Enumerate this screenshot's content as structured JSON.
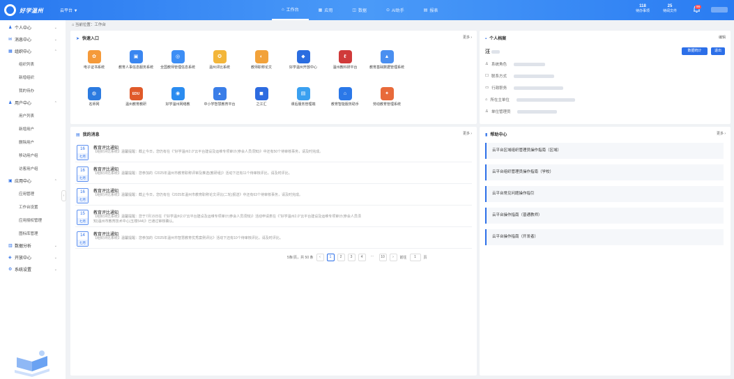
{
  "header": {
    "brand": "好学温州",
    "platform": "云平台 ▼",
    "nav": [
      {
        "label": "工作台",
        "icon": "home-icon",
        "active": true
      },
      {
        "label": "应用",
        "icon": "grid-icon",
        "active": false
      },
      {
        "label": "数据",
        "icon": "data-icon",
        "active": false
      },
      {
        "label": "AI助手",
        "icon": "ai-icon",
        "active": false
      },
      {
        "label": "报表",
        "icon": "report-icon",
        "active": false
      }
    ],
    "stat1_value": "118",
    "stat1_label": "待办事项",
    "stat2_value": "25",
    "stat2_label": "待阅文件",
    "notification_count": "99"
  },
  "sidebar": {
    "groups": [
      {
        "label": "个人中心",
        "icon": "user-icon",
        "expanded": false,
        "subs": []
      },
      {
        "label": "消息中心",
        "icon": "message-icon",
        "expanded": false,
        "subs": []
      },
      {
        "label": "组织中心",
        "icon": "org-icon",
        "expanded": true,
        "subs": [
          "组织列表",
          "新增组织",
          "我的待办"
        ]
      },
      {
        "label": "用户中心",
        "icon": "users-icon",
        "expanded": true,
        "subs": [
          "用户列表",
          "新增用户",
          "删除用户",
          "移动用户组",
          "访客用户组"
        ]
      },
      {
        "label": "应用中心",
        "icon": "app-icon",
        "expanded": true,
        "subs": [
          "应用管理",
          "工作台设置",
          "应用授权管理",
          "图标库管理"
        ]
      },
      {
        "label": "数据分析",
        "icon": "chart-icon",
        "expanded": false,
        "subs": []
      },
      {
        "label": "开放中心",
        "icon": "open-icon",
        "expanded": false,
        "subs": []
      },
      {
        "label": "系统设置",
        "icon": "settings-icon",
        "expanded": false,
        "subs": []
      }
    ]
  },
  "breadcrumb": "当前位置：工作台",
  "quick": {
    "title": "快速入口",
    "more": "更多 ›",
    "apps": [
      {
        "label": "电子证书系统",
        "color": "#f59a3a",
        "glyph": "✿"
      },
      {
        "label": "教育人事信息服务系统",
        "color": "#3a86f0",
        "glyph": "▣"
      },
      {
        "label": "全国教师管理信息系统",
        "color": "#3d8ef5",
        "glyph": "◎"
      },
      {
        "label": "温州评比系统",
        "color": "#f3b63a",
        "glyph": "✪"
      },
      {
        "label": "教师职称论文",
        "color": "#f2a23a",
        "glyph": "◐"
      },
      {
        "label": "好学温州开放中心",
        "color": "#2b6de0",
        "glyph": "◆"
      },
      {
        "label": "温州教科研平台",
        "color": "#d03a3a",
        "glyph": "ℓ"
      },
      {
        "label": "教育基础数据管理系统",
        "color": "#4a8ff0",
        "glyph": "▲"
      },
      {
        "label": "名师网",
        "color": "#2c7be0",
        "glyph": "◍"
      },
      {
        "label": "温州教育教研",
        "color": "#e05a2a",
        "glyph": "EDU"
      },
      {
        "label": "好学温州网络教",
        "color": "#2b8cf0",
        "glyph": "◉"
      },
      {
        "label": "中小学智慧教育平台",
        "color": "#3a7ee8",
        "glyph": "▴"
      },
      {
        "label": "之江汇",
        "color": "#2d6be0",
        "glyph": "◼"
      },
      {
        "label": "课后服务管理端",
        "color": "#3aa0f0",
        "glyph": "▤"
      },
      {
        "label": "教育智能服务助手",
        "color": "#2b78e8",
        "glyph": "⌂"
      },
      {
        "label": "劳动教育管理系统",
        "color": "#e86a3a",
        "glyph": "✦"
      }
    ]
  },
  "messages": {
    "title": "我的消息",
    "more": "更多 ›",
    "items": [
      {
        "day": "16",
        "month": "七月",
        "title": "教育评比通知",
        "body": "【组织评比系统】温馨提醒：截止今日，您仍有在《“好学温州2.0”云平台建设及运维专项审计(参会人员须知)》中还有50个待审核事务，请及时完成。"
      },
      {
        "day": "16",
        "month": "七月",
        "title": "教育评比通知",
        "body": "【组织评比系统】温馨提醒：您参加的《2025年温州市教育职称评审及推选(教研组)》活动下还有11个待审核评比，请及时评比。"
      },
      {
        "day": "16",
        "month": "七月",
        "title": "教育评比通知",
        "body": "【组织评比系统】温馨提醒：截止今日，您仍有在《2025年温州市教育职称论文评比(二轮)报送》中还有63个待审核事务，请及时完成。"
      },
      {
        "day": "15",
        "month": "七月",
        "title": "教育评比通知",
        "body": "【组织评比系统】温馨提醒：您于7月15日在《“好学温州2.0”云平台建设及运维专项审计(参会人员须知)》活动申请表在《“好学温州2.0”云平台建设及运维专项审计(参会人员须知)温州市教育技术中心(五楼544)》已通过审核确认。"
      },
      {
        "day": "14",
        "month": "七月",
        "title": "教育评比通知",
        "body": "【组织评比系统】温馨提醒：您参加的《2025年温州市智慧教育优秀案例评比》活动下还有10个待审核评比，请及时评比。"
      }
    ],
    "pager": {
      "info": "5条/页，共 50 条",
      "pages": [
        "1",
        "2",
        "3",
        "4",
        "···",
        "10"
      ],
      "current": "1",
      "goto_label": "前往",
      "goto_value": "1",
      "page_unit": "页"
    }
  },
  "profile": {
    "title": "个人档案",
    "edit": "编辑",
    "name": "汪",
    "btn_stats": "数据统计",
    "btn_exit": "退出",
    "rows": [
      {
        "icon": "person-icon",
        "label": "系统角色"
      },
      {
        "icon": "phone-icon",
        "label": "联系方式"
      },
      {
        "icon": "briefcase-icon",
        "label": "行政职务"
      },
      {
        "icon": "building-icon",
        "label": "所在主单位"
      },
      {
        "icon": "user-outline-icon",
        "label": "单位管理员"
      }
    ]
  },
  "help": {
    "title": "帮助中心",
    "more": "更多 ›",
    "items": [
      "云平台区域组织管理员操作指南（区域）",
      "云平台组织管理员操作指南（学校）",
      "云平台常见问题操作指引",
      "云平台操作指南（普通教师）",
      "云平台操作指南（开发者）"
    ]
  }
}
